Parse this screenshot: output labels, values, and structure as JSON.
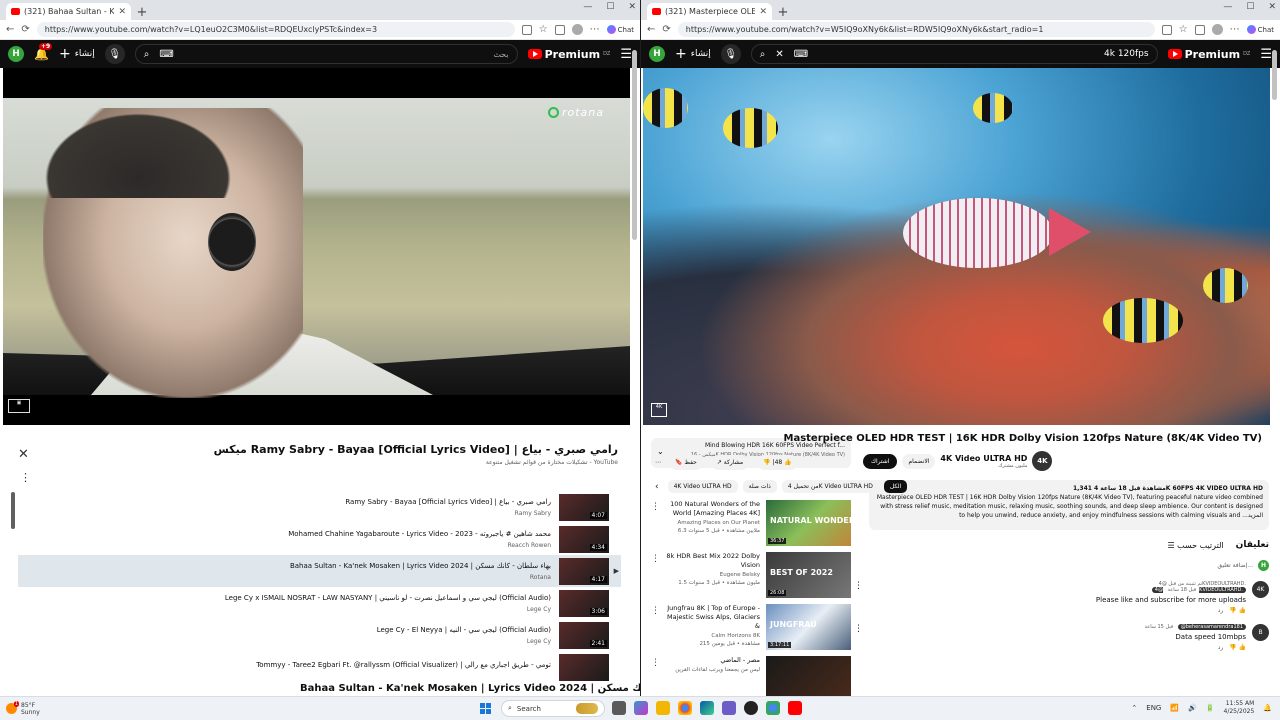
{
  "left": {
    "tab_title": "(321) Bahaa Sultan - Ka'nek M",
    "url": "https://www.youtube.com/watch?v=LQ1euO2C3M0&list=RDQEUxclyPSTc&index=3",
    "create_label": "إنشاء",
    "notif_count": "+9",
    "avatar": "H",
    "search_placeholder": "بحث",
    "premium": "Premium",
    "premium_country": "DZ",
    "video_overlay_logo": "rotana",
    "playlist": {
      "title": "ميكس Ramy Sabry - Bayaa [Official Lyrics Video] | رامي صبري - بياع",
      "subtitle": "تشكيلات مختارة من قوائم تشغيل متنوعة - YouTube",
      "items": [
        {
          "title": "Ramy Sabry - Bayaa [Official Lyrics Video] | رامي صبري - بياع",
          "channel": "Ramy Sabry",
          "duration": "4:07",
          "active": false
        },
        {
          "title": "Mohamed Chahine Yagabaroute - Lyrics Video - 2023 - محمد شاهين # ياجبروته",
          "channel": "Reacch Rowen",
          "duration": "4:34",
          "active": false
        },
        {
          "title": "Bahaa Sultan - Ka'nek Mosaken | Lyrics Video 2024 | بهاء سلطان - كأنك مسكن",
          "channel": "Rotana",
          "duration": "4:17",
          "active": true
        },
        {
          "title": "Lege Cy x ISMAIL NOSRAT - LAW NASYANY | ليجي سي و اسماعيل نصرت - لو ناسيني (Official Audio)",
          "channel": "Lege Cy",
          "duration": "3:06",
          "active": false
        },
        {
          "title": "Lege Cy - El Neyya | ليجي سي - النيه (Official Audio)",
          "channel": "Lege Cy",
          "duration": "2:41",
          "active": false
        },
        {
          "title": "Tommyy - Taree2 Egbari Ft. @rallyssm (Official Visualizer) | تومي - طريق اجباري مع رالي",
          "channel": "",
          "duration": "",
          "active": false
        }
      ]
    },
    "bottom_title": "Bahaa Sultan - Ka'nek Mosaken | Lyrics Video 2024 | بهاء سلطان - كأنك مسكن"
  },
  "right": {
    "tab_title": "(321) Masterpiece OLED HDR TEST",
    "url": "https://www.youtube.com/watch?v=W5IQ9oXNy6k&list=RDW5IQ9oXNy6k&start_radio=1",
    "create_label": "إنشاء",
    "avatar": "H",
    "search_query": "4k 120fps",
    "premium": "Premium",
    "premium_country": "DZ",
    "video_title": "Masterpiece OLED HDR TEST | 16K HDR Dolby Vision 120fps Nature (8K/4K Video TV)",
    "channel": {
      "name": "4K Video ULTRA HD",
      "subs": "مليون مشترك",
      "avatar": "4K"
    },
    "subscribe": "اشتراك",
    "join": "الانضمام",
    "likes": "48",
    "share": "مشاركة",
    "save": "حفظ",
    "more": "...",
    "description": {
      "meta": "1,341 مشاهدة قبل 18 ساعة  4K 60FPS  4K VIDEO ULTRA HD",
      "text": "Masterpiece OLED HDR TEST | 16K HDR Dolby Vision 120fps Nature (8K/4K Video TV), featuring peaceful nature video combined with stress relief music, meditation music, relaxing music, soothing sounds, and deep sleep ambience. Our content is designed to help you unwind, reduce anxiety, and enjoy mindfulness sessions with calming visuals and ...المزيد"
    },
    "comments": {
      "title": "تعليقان",
      "sort": "الترتيب حسب",
      "add_placeholder": "إضافة تعليق...",
      "items": [
        {
          "author": "@4KVIDEOULTRAHD.",
          "time": "قبل 18 ساعة",
          "pinned": "تم تثبيته من قبل @4KVIDEOULTRAHD.",
          "text": "Please like and subscribe for more uploads",
          "reply": "رد",
          "avatar": "4K"
        },
        {
          "author": "@beherasamarendra181",
          "time": "قبل 15 ساعة",
          "text": "Data speed 10mbps",
          "reply": "رد",
          "avatar": "B"
        }
      ]
    },
    "mini_playlist": {
      "title": "Mind Blowing HDR 16K 60FPS Video Perfect f...",
      "subtitle": "ميكس - 16K HDR Dolby Vision 120fps Nature (8K/4K Video TV)"
    },
    "chips": [
      "الكل",
      "من تحميل 4K Video ULTRA HD",
      "ذات صلة",
      "4K Video ULTRA HD"
    ],
    "recommendations": [
      {
        "title": "100 Natural Wonders of the World [Amazing Places 4K]",
        "channel": "Amazing Places on Our Planet",
        "stats": "6.3 ملايين مشاهدة • قبل 5 سنوات",
        "duration": "36:37",
        "overlay": "NATURAL WONDERS"
      },
      {
        "title": "8k HDR Best Mix 2022 Dolby Vision",
        "channel": "Eugene Belsky",
        "stats": "1.5 مليون مشاهدة • قبل 3 سنوات",
        "duration": "26:08",
        "overlay": "BEST OF 2022"
      },
      {
        "title": "Jungfrau 8K | Top of Europe - Majestic Swiss Alps, Glaciers &",
        "channel": "Calm Horizons 8K",
        "stats": "215 مشاهدة • قبل يومين",
        "duration": "3:17:11",
        "overlay": "JUNGFRAU"
      },
      {
        "title": "مصر - الماضي",
        "channel": "ليس من يجمعنا ويرتب لقاءات القرين",
        "stats": "",
        "duration": "",
        "overlay": ""
      }
    ]
  },
  "taskbar": {
    "temp": "85°F",
    "weather": "Sunny",
    "weather_badge": "1",
    "search": "Search",
    "lang": "ENG",
    "time": "11:55 AM",
    "date": "4/25/2025"
  }
}
